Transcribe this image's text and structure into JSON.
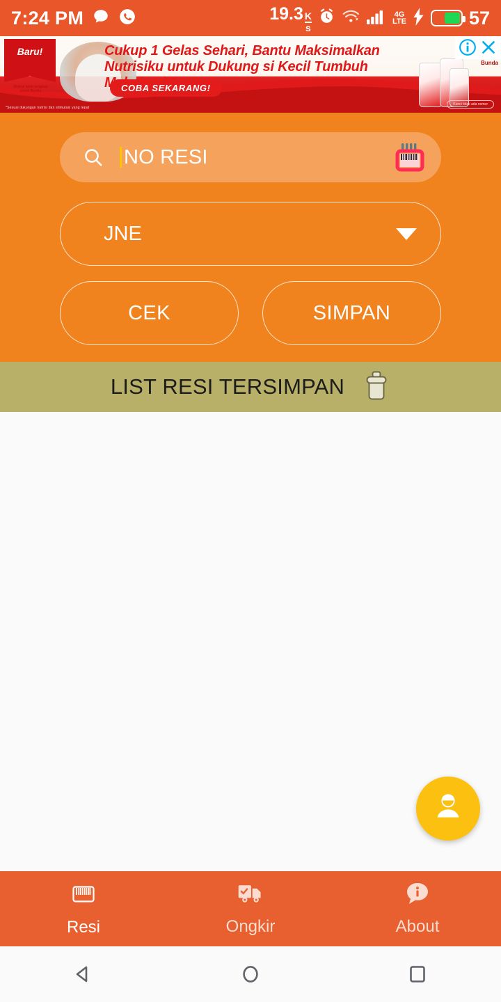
{
  "status_bar": {
    "time": "7:24 PM",
    "icons_left": [
      "chat-bubble-icon",
      "whatsapp-icon"
    ],
    "network_speed": "19.3",
    "speed_unit_top": "K",
    "speed_unit_bottom": "s",
    "icons_right": [
      "alarm-icon",
      "wifi-icon",
      "signal-bars-icon",
      "4g-lte-icon",
      "charging-bolt-icon"
    ],
    "network_type_top": "4G",
    "network_type_bottom": "LTE",
    "battery_percent": "57",
    "battery_level": 58,
    "bg_color": "#E8562A"
  },
  "ad": {
    "brand": "Baru!",
    "brand_sub": "Nutrisi lebih lengkap untuk Bunda",
    "headline": "Cukup 1 Gelas Sehari,  Bantu Maksimalkan Nutrisiku untuk Dukung si Kecil Tumbuh Maksimal!*",
    "cta": "COBA SEKARANG!",
    "product_label": "Bunda",
    "disclaimer": "*Sesuai dukungan nutrisi dan stimulasi yang tepat",
    "badge": "Kunci tidak ada nomor",
    "info_icon": "adchoices-info-icon",
    "close_icon": "close-icon"
  },
  "search": {
    "icon": "search-icon",
    "placeholder": "NO RESI",
    "value": "",
    "scan_icon": "barcode-scanner-icon",
    "caret_color": "#FFC400",
    "field_bg": "#F5A35C"
  },
  "courier_select": {
    "value": "JNE",
    "chevron_icon": "chevron-down-icon",
    "options": [
      "JNE"
    ]
  },
  "actions": {
    "check_label": "CEK",
    "save_label": "SIMPAN"
  },
  "saved_list": {
    "header": "LIST RESI TERSIMPAN",
    "delete_icon": "trash-icon",
    "header_bg": "#B8B068",
    "items": []
  },
  "fab": {
    "icon": "person-icon",
    "color": "#FCC011"
  },
  "bottom_nav": {
    "bg_color": "#E8602F",
    "items": [
      {
        "label": "Resi",
        "icon": "barcode-icon",
        "active": true
      },
      {
        "label": "Ongkir",
        "icon": "delivery-truck-check-icon",
        "active": false
      },
      {
        "label": "About",
        "icon": "info-bubble-icon",
        "active": false
      }
    ]
  },
  "android_nav": {
    "back": "back-triangle-icon",
    "home": "home-circle-icon",
    "recents": "recents-square-icon"
  },
  "theme": {
    "primary_orange": "#F1831F",
    "status_orange": "#E8562A",
    "khaki": "#B8B068",
    "amber": "#FCC011",
    "body_bg": "#FAFAFA"
  }
}
